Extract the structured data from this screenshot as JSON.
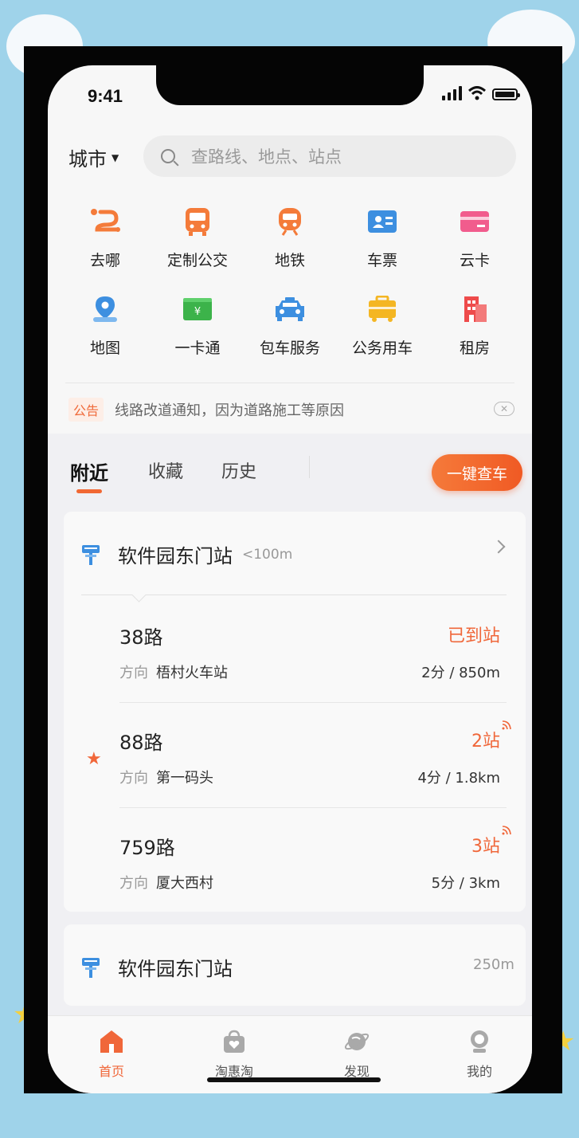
{
  "status_bar": {
    "time": "9:41"
  },
  "header": {
    "city_label": "城市",
    "search_placeholder": "查路线、地点、站点"
  },
  "quick_actions": [
    [
      {
        "label": "去哪",
        "icon": "route-icon"
      },
      {
        "label": "定制公交",
        "icon": "bus-icon"
      },
      {
        "label": "地铁",
        "icon": "metro-icon"
      },
      {
        "label": "车票",
        "icon": "ticket-icon"
      },
      {
        "label": "云卡",
        "icon": "card-icon"
      }
    ],
    [
      {
        "label": "地图",
        "icon": "map-pin-icon"
      },
      {
        "label": "一卡通",
        "icon": "cash-card-icon"
      },
      {
        "label": "包车服务",
        "icon": "taxi-icon"
      },
      {
        "label": "公务用车",
        "icon": "briefcase-car-icon"
      },
      {
        "label": "租房",
        "icon": "building-icon"
      }
    ]
  ],
  "notice": {
    "tag": "公告",
    "text": "线路改道通知，因为道路施工等原因"
  },
  "tabs": {
    "nearby": "附近",
    "favorites": "收藏",
    "history": "历史",
    "cta": "一键查车"
  },
  "nearby_stops": [
    {
      "name": "软件园东门站",
      "distance": "<100m",
      "routes": [
        {
          "name": "38路",
          "direction_label": "方向",
          "direction": "梧村火车站",
          "status": "已到站",
          "eta": "2分 / 850m",
          "favorite": false
        },
        {
          "name": "88路",
          "direction_label": "方向",
          "direction": "第一码头",
          "status": "2站",
          "eta": "4分 / 1.8km",
          "favorite": true
        },
        {
          "name": "759路",
          "direction_label": "方向",
          "direction": "厦大西村",
          "status": "3站",
          "eta": "5分 / 3km",
          "favorite": false
        }
      ]
    },
    {
      "name": "软件园东门站",
      "distance": "250m"
    }
  ],
  "bottom_nav": [
    {
      "label": "首页",
      "icon": "home-icon",
      "active": true
    },
    {
      "label": "淘惠淘",
      "icon": "shopping-bag-icon",
      "active": false
    },
    {
      "label": "发现",
      "icon": "planet-icon",
      "active": false
    },
    {
      "label": "我的",
      "icon": "profile-icon",
      "active": false
    }
  ],
  "colors": {
    "accent": "#f0673a",
    "background": "#9fd3ea"
  }
}
